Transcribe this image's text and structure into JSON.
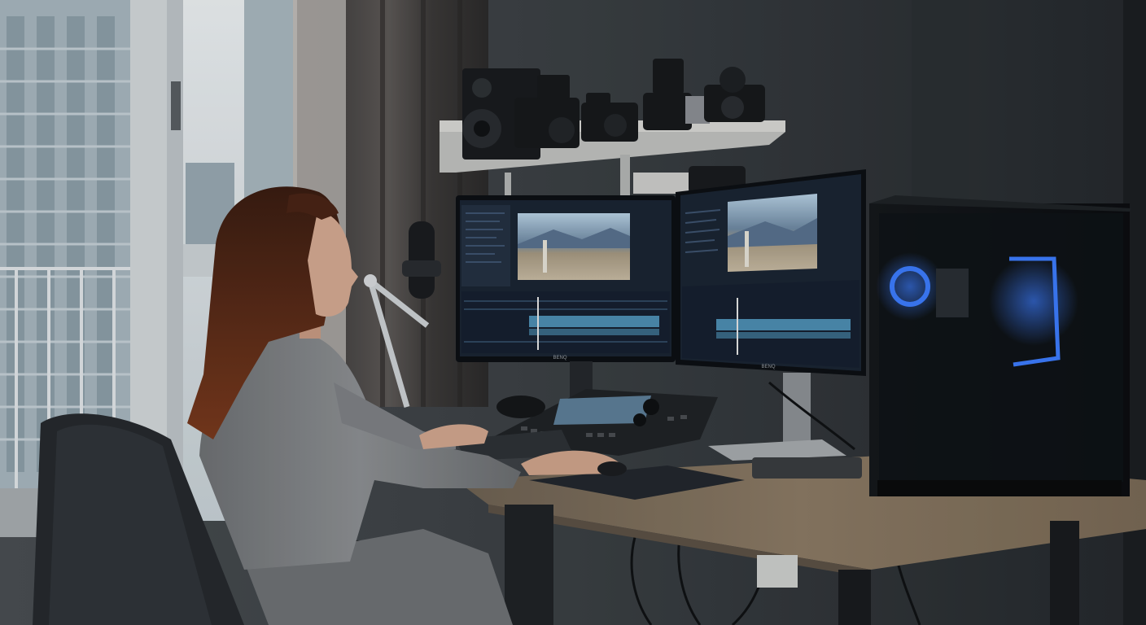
{
  "scene": {
    "kind": "photo",
    "elements": [
      "window",
      "curtain",
      "wall-shelf",
      "speaker",
      "cameras",
      "microphone-arm",
      "left-monitor",
      "right-monitor",
      "editing-console",
      "keyboard",
      "mouse-pad",
      "desk",
      "pc-tower",
      "office-chair",
      "person"
    ]
  },
  "monitor_brand": "BENQ",
  "palette": {
    "wall": "#3a3f44",
    "desk": "#8c7a63",
    "screen_ui": "#1b2533",
    "rgb_accent": "#2a6cff",
    "sky": "#dfe6ea",
    "sweater": "#8d9094",
    "hair": "#6a2e18"
  }
}
